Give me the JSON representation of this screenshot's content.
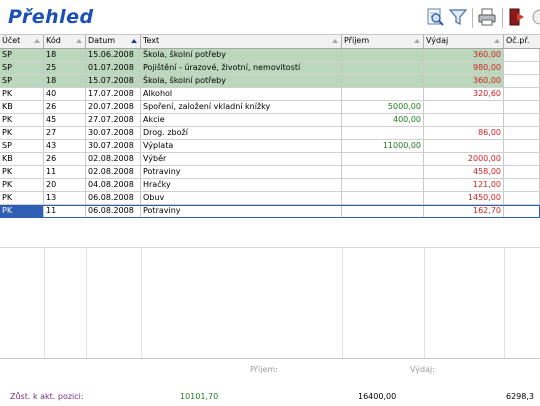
{
  "header": {
    "title": "Přehled"
  },
  "toolbar": {
    "icons": [
      "preview-icon",
      "filter-icon",
      "print-icon",
      "exit-icon",
      "help-icon"
    ]
  },
  "columns": [
    {
      "label": "Účet"
    },
    {
      "label": "Kód"
    },
    {
      "label": "Datum"
    },
    {
      "label": "Text"
    },
    {
      "label": "Příjem"
    },
    {
      "label": "Výdaj"
    },
    {
      "label": "Oč.př."
    }
  ],
  "sort_column": "Datum",
  "colors": {
    "highlight_row": "#bcd8bc",
    "income": "#1f7a1f",
    "expense": "#d21f1f",
    "selection": "#2f5fb5",
    "title": "#1c4fb8"
  },
  "rows": [
    {
      "ucet": "SP",
      "kod": "18",
      "datum": "15.06.2008",
      "text": "Škola, školní potřeby",
      "prijem": "",
      "vydaj": "360,00",
      "oc": "",
      "green": true
    },
    {
      "ucet": "SP",
      "kod": "25",
      "datum": "01.07.2008",
      "text": "Pojištění - úrazové, životní, nemovitostí",
      "prijem": "",
      "vydaj": "980,00",
      "oc": "",
      "green": true
    },
    {
      "ucet": "SP",
      "kod": "18",
      "datum": "15.07.2008",
      "text": "Škola, školní potřeby",
      "prijem": "",
      "vydaj": "360,00",
      "oc": "",
      "green": true
    },
    {
      "ucet": "PK",
      "kod": "40",
      "datum": "17.07.2008",
      "text": "Alkohol",
      "prijem": "",
      "vydaj": "320,60",
      "oc": ""
    },
    {
      "ucet": "KB",
      "kod": "26",
      "datum": "20.07.2008",
      "text": "Spoření, založení vkladní knížky",
      "prijem": "5000,00",
      "vydaj": "",
      "oc": ""
    },
    {
      "ucet": "PK",
      "kod": "45",
      "datum": "27.07.2008",
      "text": "Akcie",
      "prijem": "400,00",
      "vydaj": "",
      "oc": ""
    },
    {
      "ucet": "PK",
      "kod": "27",
      "datum": "30.07.2008",
      "text": "Drog. zboží",
      "prijem": "",
      "vydaj": "86,00",
      "oc": ""
    },
    {
      "ucet": "SP",
      "kod": "43",
      "datum": "30.07.2008",
      "text": "Výplata",
      "prijem": "11000,00",
      "vydaj": "",
      "oc": ""
    },
    {
      "ucet": "KB",
      "kod": "26",
      "datum": "02.08.2008",
      "text": "Výběr",
      "prijem": "",
      "vydaj": "2000,00",
      "oc": ""
    },
    {
      "ucet": "PK",
      "kod": "11",
      "datum": "02.08.2008",
      "text": "Potraviny",
      "prijem": "",
      "vydaj": "458,00",
      "oc": ""
    },
    {
      "ucet": "PK",
      "kod": "20",
      "datum": "04.08.2008",
      "text": "Hračky",
      "prijem": "",
      "vydaj": "121,00",
      "oc": ""
    },
    {
      "ucet": "PK",
      "kod": "13",
      "datum": "06.08.2008",
      "text": "Obuv",
      "prijem": "",
      "vydaj": "1450,00",
      "oc": ""
    },
    {
      "ucet": "PK",
      "kod": "11",
      "datum": "06.08.2008",
      "text": "Potraviny",
      "prijem": "",
      "vydaj": "162,70",
      "oc": "",
      "selected": true
    }
  ],
  "footer": {
    "prijem_label": "Příjem:",
    "vydaj_label": "Výdaj:",
    "zust_label": "Zůst. k akt. pozici:",
    "zust_value": "10101,70",
    "prijem_total": "16400,00",
    "vydaj_total": "6298,3"
  }
}
